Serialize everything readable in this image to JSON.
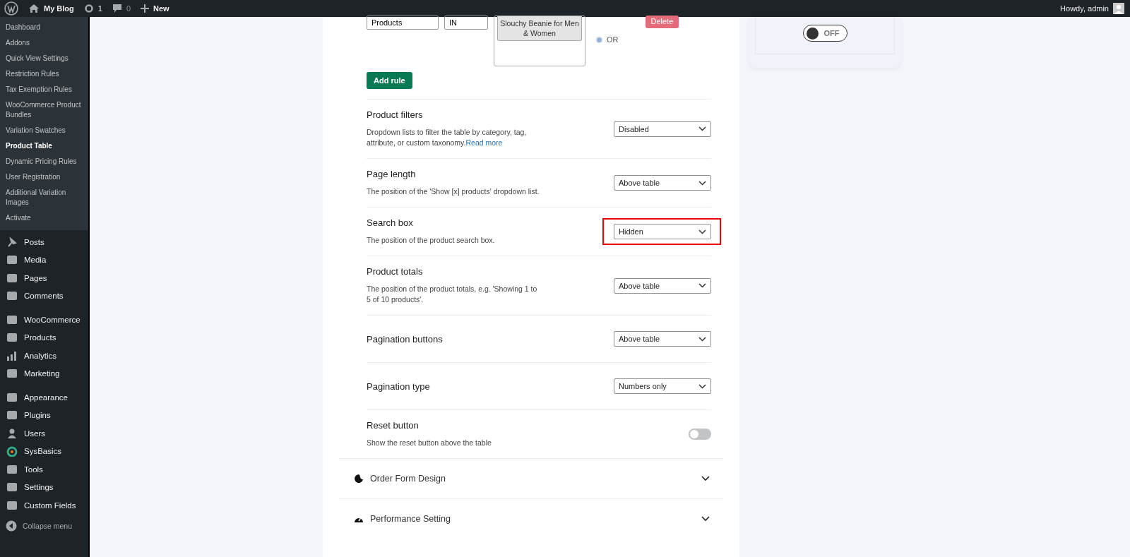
{
  "admin_bar": {
    "site": "My Blog",
    "updates": "1",
    "comments": "0",
    "new": "New",
    "greeting": "Howdy, admin"
  },
  "submenu": [
    {
      "label": "Dashboard",
      "selected": false
    },
    {
      "label": "Addons",
      "selected": false
    },
    {
      "label": "Quick View Settings",
      "selected": false
    },
    {
      "label": "Restriction Rules",
      "selected": false
    },
    {
      "label": "Tax Exemption Rules",
      "selected": false
    },
    {
      "label": "WooCommerce Product Bundles",
      "selected": false
    },
    {
      "label": "Variation Swatches",
      "selected": false
    },
    {
      "label": "Product Table",
      "selected": true
    },
    {
      "label": "Dynamic Pricing Rules",
      "selected": false
    },
    {
      "label": "User Registration",
      "selected": false
    },
    {
      "label": "Additional Variation Images",
      "selected": false
    },
    {
      "label": "Activate",
      "selected": false
    }
  ],
  "menu_groups": [
    [
      "Posts",
      "Media",
      "Pages",
      "Comments"
    ],
    [
      "WooCommerce",
      "Products",
      "Analytics",
      "Marketing"
    ],
    [
      "Appearance",
      "Plugins",
      "Users",
      "SysBasics",
      "Tools",
      "Settings",
      "Custom Fields"
    ]
  ],
  "collapse_menu": "Collapse menu",
  "rule": {
    "field": "Products",
    "operator": "IN",
    "tag": "Slouchy Beanie for Men & Women",
    "relation": "OR",
    "relation_selected": true,
    "delete": "Delete",
    "add": "Add rule"
  },
  "settings": [
    {
      "kind": "select",
      "title": "Product filters",
      "description": "Dropdown lists to filter the table by category, tag, attribute, or custom taxonomy.",
      "link": "Read more",
      "value": "Disabled",
      "highlighted": false
    },
    {
      "kind": "select",
      "title": "Page length",
      "description": "The position of the 'Show [x] products' dropdown list.",
      "value": "Above table",
      "highlighted": false
    },
    {
      "kind": "select",
      "title": "Search box",
      "description": "The position of the product search box.",
      "value": "Hidden",
      "highlighted": true
    },
    {
      "kind": "select",
      "title": "Product totals",
      "description": "The position of the product totals, e.g. 'Showing 1 to 5 of 10 products'.",
      "value": "Above table",
      "highlighted": false
    },
    {
      "kind": "select",
      "title": "Pagination buttons",
      "value": "Above table",
      "highlighted": false
    },
    {
      "kind": "select",
      "title": "Pagination type",
      "value": "Numbers only",
      "highlighted": false
    },
    {
      "kind": "toggle",
      "title": "Reset button",
      "description": "Show the reset button above the table",
      "on": false
    }
  ],
  "sections": [
    {
      "title": "Order Form Design",
      "expanded": false
    },
    {
      "title": "Performance Setting",
      "expanded": false
    }
  ],
  "side_panel": {
    "toggle_label": "OFF",
    "on": false
  }
}
